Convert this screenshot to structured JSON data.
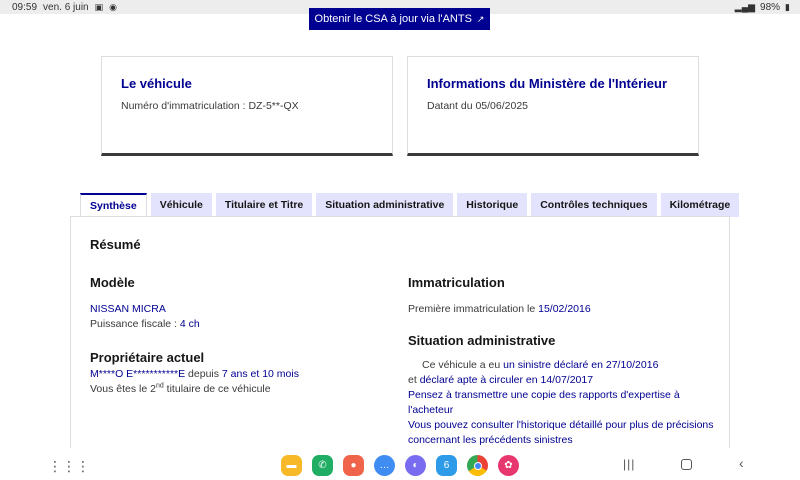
{
  "statusbar": {
    "time": "09:59",
    "date": "ven. 6 juin",
    "battery": "98%"
  },
  "csa_button": {
    "label": "Obtenir le CSA à jour via l'ANTS"
  },
  "cards": {
    "vehicle": {
      "title": "Le véhicule",
      "label": "Numéro d'immatriculation : DZ-5**-QX"
    },
    "ministry": {
      "title": "Informations du Ministère de l'Intérieur",
      "label": "Datant du 05/06/2025"
    }
  },
  "tabs": [
    {
      "label": "Synthèse"
    },
    {
      "label": "Véhicule"
    },
    {
      "label": "Titulaire et Titre"
    },
    {
      "label": "Situation administrative"
    },
    {
      "label": "Historique"
    },
    {
      "label": "Contrôles techniques"
    },
    {
      "label": "Kilométrage"
    }
  ],
  "summary": {
    "title": "Résumé",
    "modele": {
      "title": "Modèle",
      "name": "NISSAN MICRA",
      "power_label": "Puissance fiscale : ",
      "power_value": "4 ch"
    },
    "proprietaire": {
      "title": "Propriétaire actuel",
      "name": "M****O E***********E",
      "since_prefix": " depuis ",
      "since_value": "7 ans et 10 mois",
      "rank_prefix": "Vous êtes le 2",
      "rank_sup": "nd",
      "rank_suffix": " titulaire de ce véhicule"
    },
    "immatriculation": {
      "title": "Immatriculation",
      "label": "Première immatriculation le ",
      "date": "15/02/2016"
    },
    "situation": {
      "title": "Situation administrative",
      "line1_prefix": "Ce véhicule a eu ",
      "line1_link": "un sinistre déclaré en 27/10/2016",
      "line2_prefix": "et ",
      "line2_link": "déclaré apte à circuler en 14/07/2017",
      "line3": "Pensez à transmettre une copie des rapports d'expertise à l'acheteur",
      "line4": "Vous pouvez consulter l'historique détaillé pour plus de précisions concernant les précédents sinistres"
    }
  },
  "navbar": {
    "apps": [
      {
        "icon": "folder-icon",
        "color": "#f7b928"
      },
      {
        "icon": "phone-icon",
        "color": "#1fae64"
      },
      {
        "icon": "contacts-icon",
        "color": "#f0644b"
      },
      {
        "icon": "messages-icon",
        "color": "#3f8cf2"
      },
      {
        "icon": "internet-icon",
        "color": "#7a6cf0"
      },
      {
        "icon": "calendar-icon",
        "color": "#2d9be8"
      },
      {
        "icon": "chrome-icon",
        "color": "#ffffff"
      },
      {
        "icon": "gallery-icon",
        "color": "#e8376e"
      }
    ]
  }
}
